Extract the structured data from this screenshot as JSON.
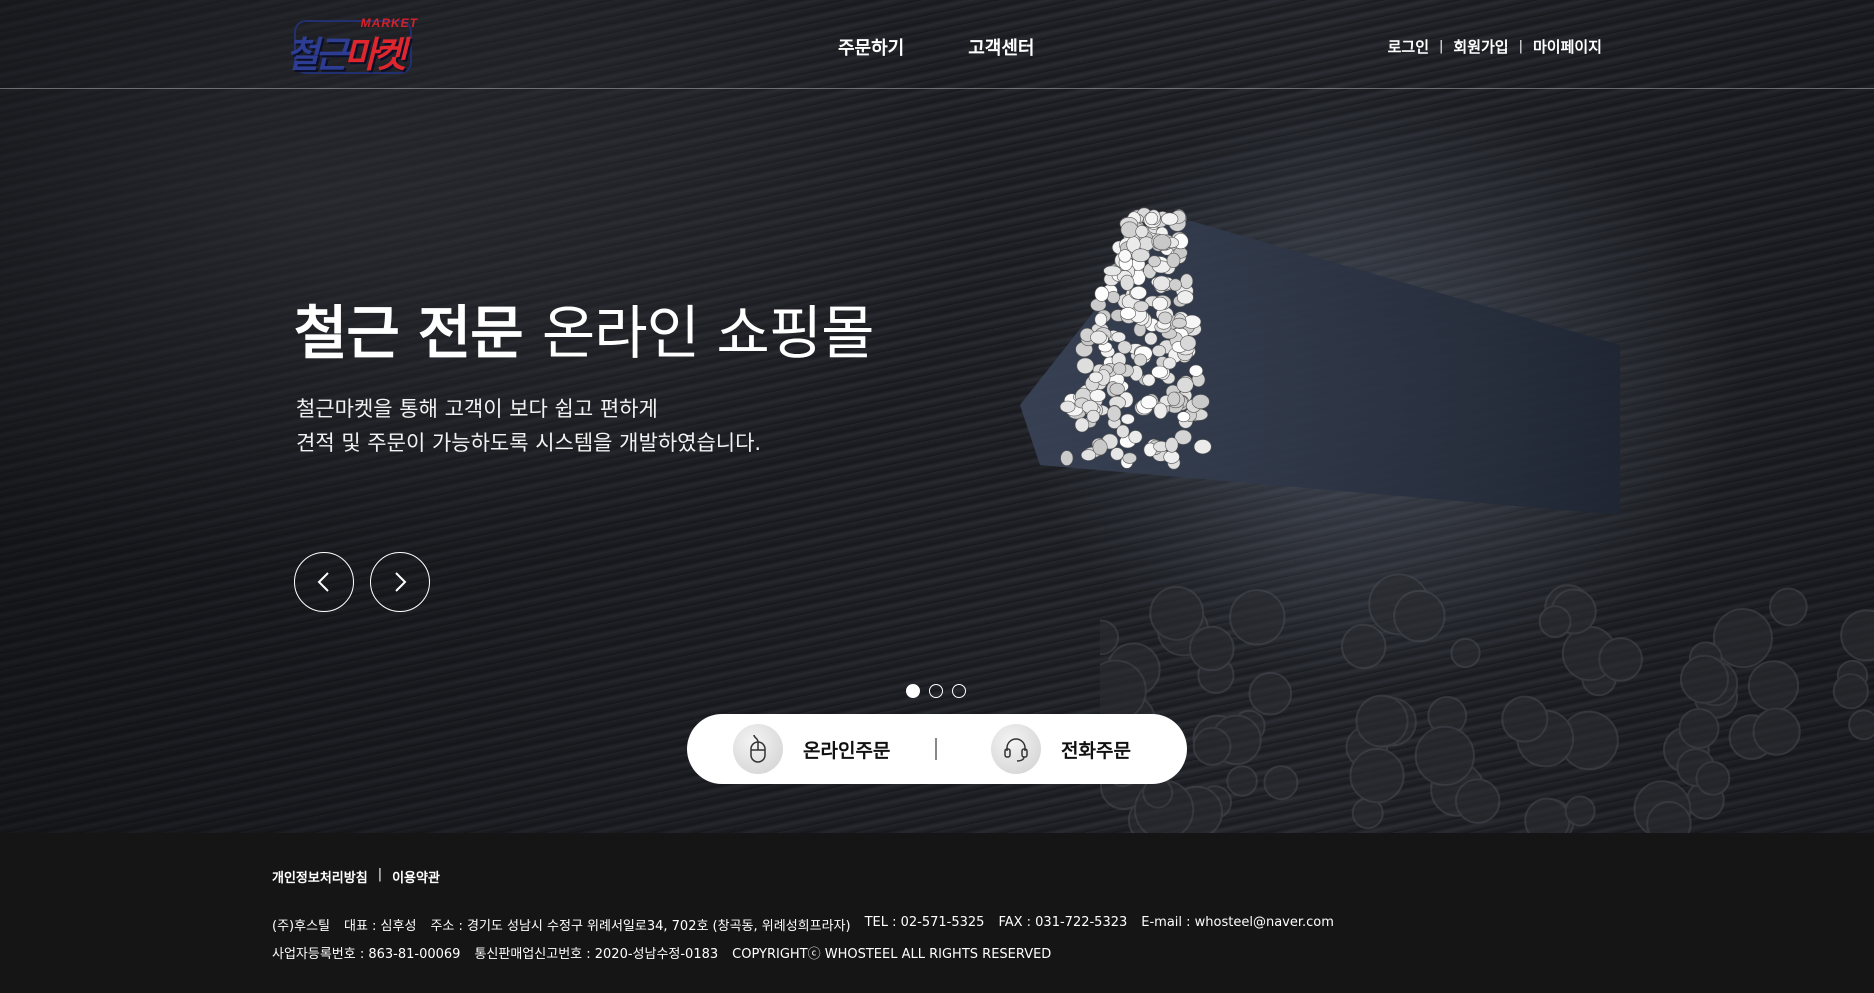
{
  "header": {
    "logo": {
      "market": "MARKET",
      "part_a": "철근",
      "part_b": "마켓"
    },
    "main_nav": [
      "주문하기",
      "고객센터"
    ],
    "util_nav": {
      "login": "로그인",
      "signup": "회원가입",
      "mypage": "마이페이지",
      "separator": "|"
    }
  },
  "hero": {
    "title_strong": "철근 전문",
    "title_light": "온라인 쇼핑몰",
    "desc_line1": "철근마켓을 통해 고객이 보다 쉽고 편하게",
    "desc_line2": "견적 및 주문이 가능하도록 시스템을 개발하였습니다.",
    "slider": {
      "total": 3,
      "active_index": 0
    }
  },
  "order_bar": {
    "online": {
      "label": "온라인주문",
      "icon": "mouse-icon"
    },
    "phone": {
      "label": "전화주문",
      "icon": "headset-icon"
    }
  },
  "footer": {
    "links": {
      "privacy": "개인정보처리방침",
      "terms": "이용약관",
      "separator": "|"
    },
    "info_line1": [
      "(주)후스틸",
      "대표 : 심후성",
      "주소 : 경기도 성남시 수정구 위례서일로34, 702호 (창곡동, 위례성희프라자)",
      "TEL : 02-571-5325",
      "FAX : 031-722-5323",
      "E-mail : whosteel@naver.com"
    ],
    "info_line2": [
      "사업자등록번호 : 863-81-00069",
      "통신판매업신고번호 : 2020-성남수정-0183",
      "COPYRIGHTⓒ WHOSTEEL ALL RIGHTS RESERVED"
    ]
  },
  "colors": {
    "logo_blue": "#2d3d93",
    "logo_red": "#e0262d",
    "footer_bg": "#151515"
  }
}
